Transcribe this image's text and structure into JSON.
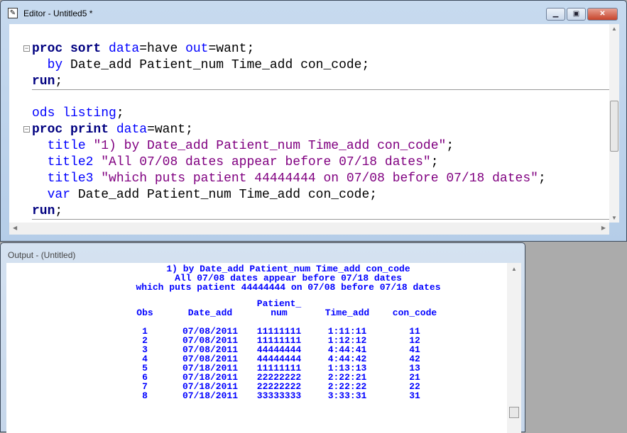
{
  "editor": {
    "title": "Editor - Untitled5 *",
    "code": [
      [
        {
          "t": "proc sort",
          "c": "kw"
        },
        {
          "t": " "
        },
        {
          "t": "data",
          "c": "bl"
        },
        {
          "t": "=have "
        },
        {
          "t": "out",
          "c": "bl"
        },
        {
          "t": "=want;"
        }
      ],
      [
        {
          "t": "  "
        },
        {
          "t": "by",
          "c": "bl"
        },
        {
          "t": " Date_add Patient_num Time_add con_code;"
        }
      ],
      [
        {
          "t": "run",
          "c": "kw"
        },
        {
          "t": ";"
        }
      ],
      [],
      [
        {
          "t": "ods listing",
          "c": "bl"
        },
        {
          "t": ";"
        }
      ],
      [
        {
          "t": "proc print",
          "c": "kw"
        },
        {
          "t": " "
        },
        {
          "t": "data",
          "c": "bl"
        },
        {
          "t": "=want;"
        }
      ],
      [
        {
          "t": "  "
        },
        {
          "t": "title",
          "c": "bl"
        },
        {
          "t": " "
        },
        {
          "t": "\"1) by Date_add Patient_num Time_add con_code\"",
          "c": "st"
        },
        {
          "t": ";"
        }
      ],
      [
        {
          "t": "  "
        },
        {
          "t": "title2",
          "c": "bl"
        },
        {
          "t": " "
        },
        {
          "t": "\"All 07/08 dates appear before 07/18 dates\"",
          "c": "st"
        },
        {
          "t": ";"
        }
      ],
      [
        {
          "t": "  "
        },
        {
          "t": "title3",
          "c": "bl"
        },
        {
          "t": " "
        },
        {
          "t": "\"which puts patient 44444444 on 07/08 before 07/18 dates\"",
          "c": "st"
        },
        {
          "t": ";"
        }
      ],
      [
        {
          "t": "  "
        },
        {
          "t": "var",
          "c": "bl"
        },
        {
          "t": " Date_add Patient_num Time_add con_code;"
        }
      ],
      [
        {
          "t": "run",
          "c": "kw"
        },
        {
          "t": ";"
        }
      ]
    ]
  },
  "output": {
    "title": "Output - (Untitled)",
    "titles": [
      "1) by Date_add Patient_num Time_add con_code",
      "All 07/08 dates appear before 07/18 dates",
      "which puts patient 44444444 on 07/08 before 07/18 dates"
    ],
    "headers": [
      "Obs",
      "Date_add",
      "Patient_\nnum",
      "Time_add",
      "con_code"
    ],
    "rows": [
      [
        "1",
        "07/08/2011",
        "11111111",
        "1:11:11",
        "11"
      ],
      [
        "2",
        "07/08/2011",
        "11111111",
        "1:12:12",
        "12"
      ],
      [
        "3",
        "07/08/2011",
        "44444444",
        "4:44:41",
        "41"
      ],
      [
        "4",
        "07/08/2011",
        "44444444",
        "4:44:42",
        "42"
      ],
      [
        "5",
        "07/18/2011",
        "11111111",
        "1:13:13",
        "13"
      ],
      [
        "6",
        "07/18/2011",
        "22222222",
        "2:22:21",
        "21"
      ],
      [
        "7",
        "07/18/2011",
        "22222222",
        "2:22:22",
        "22"
      ],
      [
        "8",
        "07/18/2011",
        "33333333",
        "3:33:31",
        "31"
      ]
    ]
  }
}
